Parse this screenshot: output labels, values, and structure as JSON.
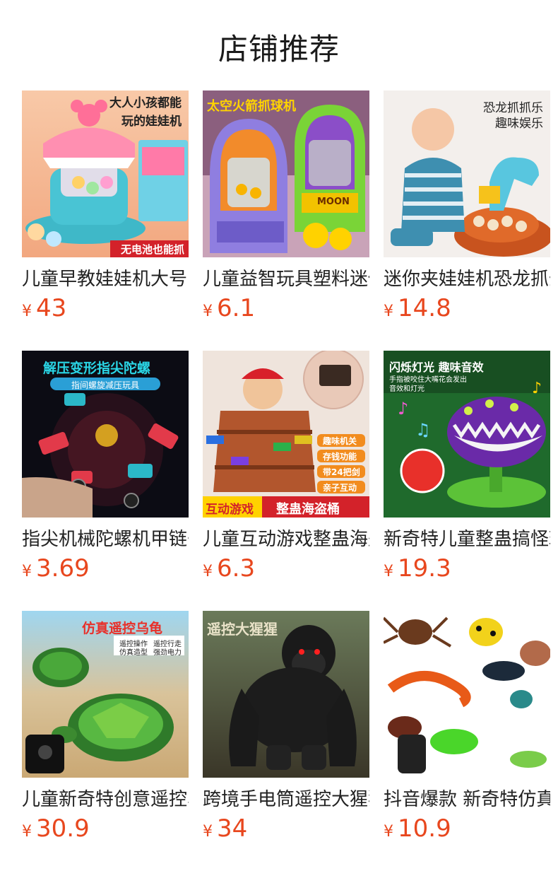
{
  "header": {
    "title": "店铺推荐"
  },
  "currency": "¥",
  "products": [
    {
      "name": "儿童早教娃娃机大号电动",
      "price": "43",
      "tags": [
        "大人小孩都能",
        "玩的娃娃机",
        "无电池也能抓"
      ],
      "image": "claw-machine"
    },
    {
      "name": "儿童益智玩具塑料迷你扭蛋",
      "price": "6.1",
      "tags": [
        "太空火箭抓球机",
        "MOON"
      ],
      "image": "rocket-claw-machine"
    },
    {
      "name": "迷你夹娃娃机恐龙抓蛋",
      "price": "14.8",
      "tags": [
        "恐龙抓抓乐",
        "趣味娱乐"
      ],
      "image": "dinosaur-claw-toy"
    },
    {
      "name": "指尖机械陀螺机甲链条",
      "price": "3.69",
      "tags": [
        "解压变形指尖陀螺",
        "指间螺旋减压玩具"
      ],
      "image": "fidget-spinner"
    },
    {
      "name": "儿童互动游戏整蛊海盗桶",
      "price": "6.3",
      "tags": [
        "趣味机关",
        "存钱功能",
        "带24把剑",
        "亲子互动",
        "互动游戏",
        "整蛊海盗桶"
      ],
      "image": "pirate-barrel"
    },
    {
      "name": "新奇特儿童整蛊搞怪玩具",
      "price": "19.3",
      "tags": [
        "闪烁灯光 趣味音效",
        "手指被咬住大嘴花会发出",
        "音效和灯光"
      ],
      "image": "piranha-plant"
    },
    {
      "name": "儿童新奇特创意遥控乌龟",
      "price": "30.9",
      "tags": [
        "仿真遥控乌龟",
        "遥控操作",
        "遥控行走",
        "仿真造型",
        "强劲电力"
      ],
      "image": "rc-turtle"
    },
    {
      "name": "跨境手电筒遥控大猩猩",
      "price": "34",
      "tags": [
        "遥控大猩猩"
      ],
      "image": "rc-gorilla"
    },
    {
      "name": "抖音爆款 新奇特仿真昆虫",
      "price": "10.9",
      "tags": [],
      "image": "rc-insects"
    }
  ],
  "colors": {
    "price": "#e8471e",
    "title": "#1a1a1a",
    "name": "#222222"
  }
}
